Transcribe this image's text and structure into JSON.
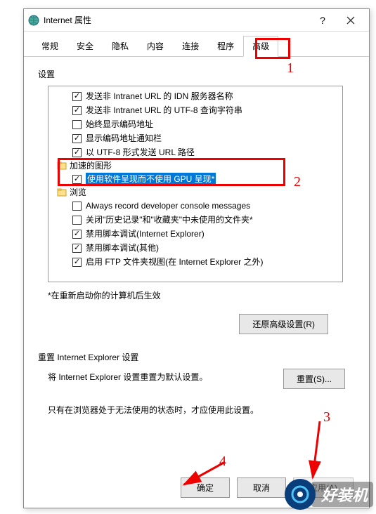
{
  "window": {
    "title": "Internet 属性"
  },
  "tabs": [
    "常规",
    "安全",
    "隐私",
    "内容",
    "连接",
    "程序",
    "高级"
  ],
  "active_tab": 6,
  "sections": {
    "settings_label": "设置",
    "note": "*在重新启动你的计算机后生效",
    "restore_btn": "还原高级设置(R)",
    "reset_title": "重置 Internet Explorer 设置",
    "reset_desc": "将 Internet Explorer 设置重置为默认设置。",
    "reset_btn": "重置(S)...",
    "reset_note": "只有在浏览器处于无法使用的状态时，才应使用此设置。"
  },
  "tree": [
    {
      "type": "item",
      "checked": true,
      "text": "发送非 Intranet URL 的 IDN 服务器名称"
    },
    {
      "type": "item",
      "checked": true,
      "text": "发送非 Intranet URL 的 UTF-8 查询字符串"
    },
    {
      "type": "item",
      "checked": false,
      "text": "始终显示编码地址"
    },
    {
      "type": "item",
      "checked": true,
      "text": "显示编码地址通知栏"
    },
    {
      "type": "item",
      "checked": true,
      "text": "以 UTF-8 形式发送 URL 路径"
    },
    {
      "type": "cat",
      "text": "加速的图形"
    },
    {
      "type": "item",
      "checked": true,
      "text": "使用软件呈现而不使用 GPU 呈现*",
      "selected": true
    },
    {
      "type": "cat",
      "text": "浏览"
    },
    {
      "type": "item",
      "checked": false,
      "text": "Always record developer console messages"
    },
    {
      "type": "item",
      "checked": false,
      "text": "关闭\"历史记录\"和\"收藏夹\"中未使用的文件夹*"
    },
    {
      "type": "item",
      "checked": true,
      "text": "禁用脚本调试(Internet Explorer)"
    },
    {
      "type": "item",
      "checked": true,
      "text": "禁用脚本调试(其他)"
    },
    {
      "type": "item",
      "checked": true,
      "text": "启用 FTP 文件夹视图(在 Internet Explorer 之外)"
    }
  ],
  "buttons": {
    "ok": "确定",
    "cancel": "取消",
    "apply": "应用(A)"
  },
  "annotations": {
    "n1": "1",
    "n2": "2",
    "n3": "3",
    "n4": "4"
  },
  "watermark": "好装机"
}
